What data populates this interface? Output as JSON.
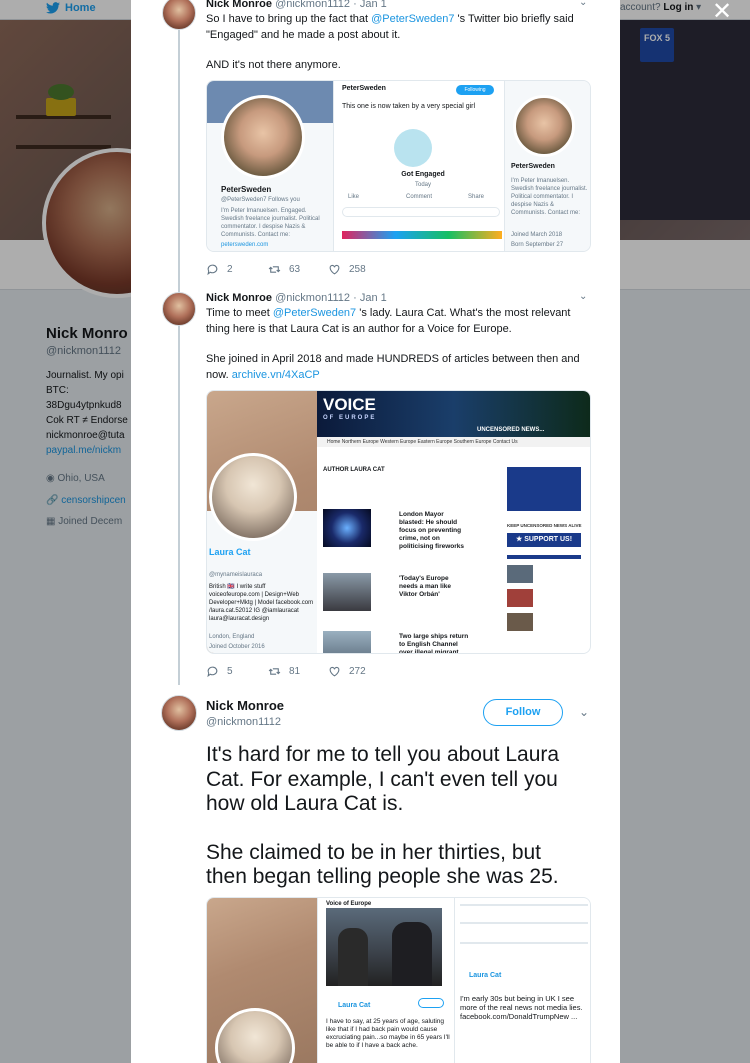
{
  "background": {
    "nav_home": "Home",
    "login_prefix": "account?",
    "login_label": "Log in",
    "fox_label": "FOX 5",
    "profile": {
      "name": "Nick Monro",
      "handle": "@nickmon1112",
      "bio_lines": [
        "Journalist. My opi",
        "BTC:",
        "38Dgu4ytpnkud8",
        "Cok RT ≠ Endorse",
        "nickmonroe@tuta"
      ],
      "bio_link": "paypal.me/nickm",
      "location": "Ohio, USA",
      "website": "censorshipcen",
      "joined": "Joined Decem"
    }
  },
  "tweets": [
    {
      "name": "Nick Monroe",
      "handle": "@nickmon1112",
      "date": "· Jan 1",
      "text_p1_before": "So I have to bring up the fact that ",
      "text_p1_mention": "@PeterSweden7",
      "text_p1_after": " 's Twitter bio briefly said \"Engaged\" and he made a post about it.",
      "text_p2": "AND it's not there anymore.",
      "media": {
        "profile_name": "PeterSweden",
        "profile_handle": "@PeterSweden7  Follows you",
        "profile_bio": "I'm Peter Imanuelsen. Engaged. Swedish freelance journalist. Political commentator. I despise Nazis & Communists. Contact me:",
        "profile_link": "petersweden.com",
        "post_name": "PeterSweden",
        "post_text": "This one is now taken by a very special girl",
        "post_event": "Got Engaged",
        "post_event_sub": "Today",
        "following_label": "Following",
        "like_label": "Like",
        "comment_label": "Comment",
        "share_label": "Share",
        "right_name": "PeterSweden",
        "right_bio": "I'm Peter Imanuelsen. Swedish freelance journalist. Political commentator. I despise Nazis & Communists. Contact me:",
        "right_joined": "Joined March 2018",
        "right_born": "Born September 27"
      },
      "replies": "2",
      "retweets": "63",
      "likes": "258"
    },
    {
      "name": "Nick Monroe",
      "handle": "@nickmon1112",
      "date": "· Jan 1",
      "text_p1_before": "Time to meet ",
      "text_p1_mention": "@PeterSweden7",
      "text_p1_after": " 's lady. Laura Cat.  What's the most relevant thing here is that Laura Cat is an author for a Voice for Europe.",
      "text_p2": "She joined in April 2018 and made HUNDREDS of articles between then and now. ",
      "text_p2_link": "archive.vn/4XaCP",
      "media": {
        "profile_name": "Laura Cat",
        "profile_handle": "@mynameislauraca",
        "profile_bio": "British 🇬🇧 I write stuff voiceofeurope.com | Design+Web Developer+Mktg | Model facebook.com /laura.cat.52012 IG @iamlauracat laura@lauracat.design",
        "profile_location": "London, England",
        "profile_joined": "Joined October 2016",
        "site_logo": "VOICE",
        "site_logo_sub": "OF EUROPE",
        "site_banner": "UNCENSORED NEWS...",
        "nav_items": "Home   Northern Europe   Western Europe   Eastern Europe   Southern Europe   Contact Us",
        "author_label": "AUTHOR  LAURA CAT",
        "article1": "London Mayor blasted: He should focus on preventing crime, not on politicising fireworks",
        "article2": "'Today's Europe needs a man like Viktor Orbán'",
        "article3": "Two large ships return to English Channel over illegal migrant crisis",
        "support_label": "★ SUPPORT US!",
        "sidebar_head": "KEEP UNCENSORED NEWS ALIVE"
      },
      "replies": "5",
      "retweets": "81",
      "likes": "272"
    },
    {
      "name": "Nick Monroe",
      "handle": "@nickmon1112",
      "follow_label": "Follow",
      "text_p1": "It's hard for me to tell you about Laura Cat. For example, I can't even tell you how old Laura Cat is.",
      "text_p2": "She claimed to be in her thirties, but then began telling people she was 25.",
      "media": {
        "left_header": "Voice of Europe",
        "mid_author": "Laura Cat",
        "mid_quote": "I have to say, at 25 years of age, saluting like that if I had back pain would cause excruciating pain...so maybe in 65 years I'll be able to if I have a back ache.",
        "right_author": "Laura Cat",
        "right_quote": "I'm early 30s but being in UK I see more of the real news not media lies. facebook.com/DonaldTrumpNew ..."
      }
    }
  ],
  "colors": {
    "accent": "#1da1f2",
    "link": "#1b95e0",
    "muted": "#657786"
  }
}
